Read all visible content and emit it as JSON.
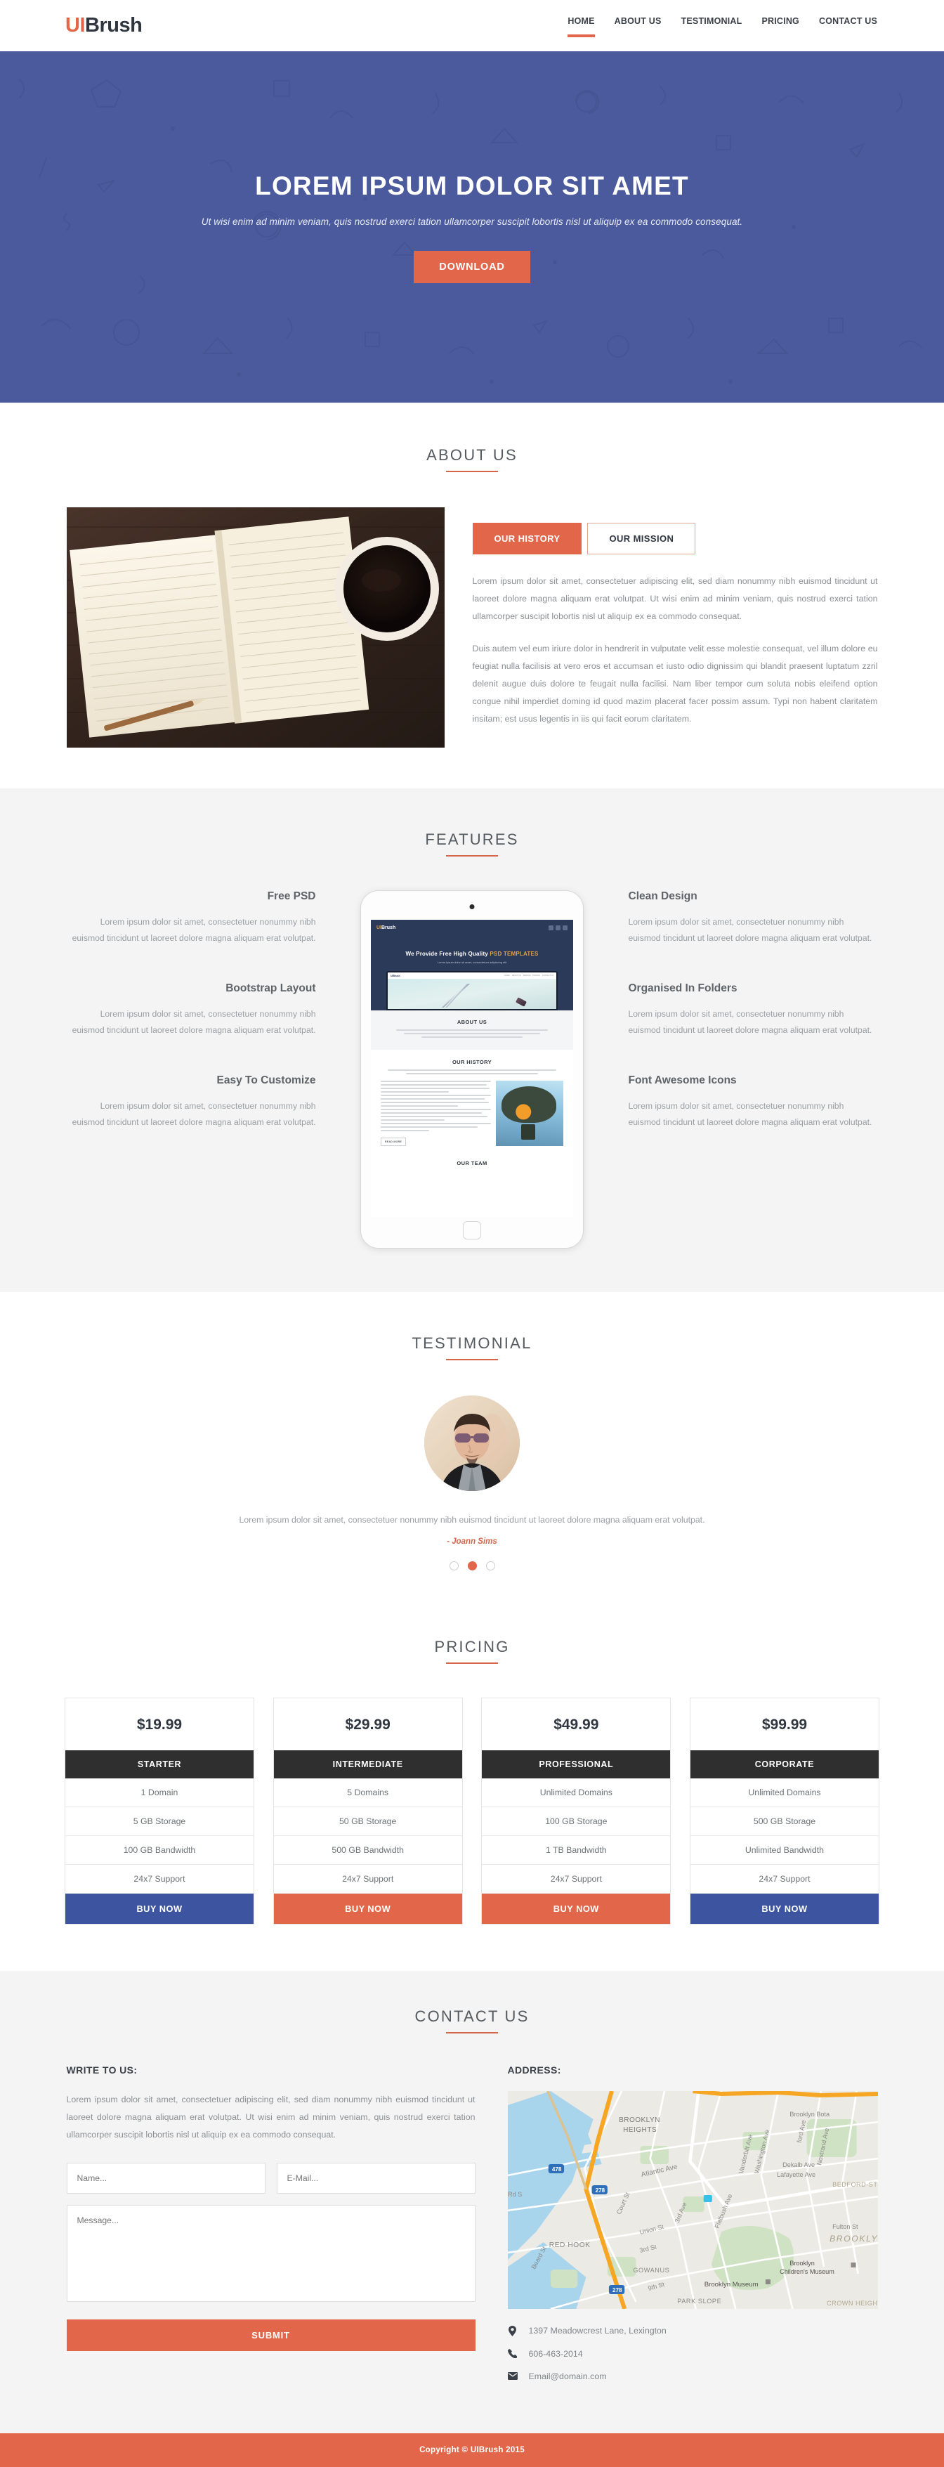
{
  "header": {
    "brand_prefix": "UI",
    "brand_suffix": "Brush",
    "nav": [
      {
        "label": "HOME",
        "active": true
      },
      {
        "label": "ABOUT US",
        "active": false
      },
      {
        "label": "TESTIMONIAL",
        "active": false
      },
      {
        "label": "PRICING",
        "active": false
      },
      {
        "label": "CONTACT US",
        "active": false
      }
    ]
  },
  "hero": {
    "title": "LOREM IPSUM DOLOR SIT AMET",
    "subtitle": "Ut wisi enim ad minim veniam, quis nostrud exerci tation ullamcorper suscipit lobortis nisl ut aliquip ex ea commodo consequat.",
    "button": "DOWNLOAD",
    "bg_color": "#4a5a9c",
    "accent_color": "#e2674a"
  },
  "about": {
    "title": "ABOUT US",
    "tabs": [
      {
        "label": "OUR HISTORY",
        "active": true
      },
      {
        "label": "OUR MISSION",
        "active": false
      }
    ],
    "paragraph1": "Lorem ipsum dolor sit amet, consectetuer adipiscing elit, sed diam nonummy nibh euismod tincidunt ut laoreet dolore magna aliquam erat volutpat. Ut wisi enim ad minim veniam, quis nostrud exerci tation ullamcorper suscipit lobortis nisl ut aliquip ex ea commodo consequat.",
    "paragraph2": "Duis autem vel eum iriure dolor in hendrerit in vulputate velit esse molestie consequat, vel illum dolore eu feugiat nulla facilisis at vero eros et accumsan et iusto odio dignissim qui blandit praesent luptatum zzril delenit augue duis dolore te feugait nulla facilisi. Nam liber tempor cum soluta nobis eleifend option congue nihil imperdiet doming id quod mazim placerat facer possim assum. Typi non habent claritatem insitam; est usus legentis in iis qui facit eorum claritatem."
  },
  "features": {
    "title": "FEATURES",
    "body_text": "Lorem ipsum dolor sit amet, consectetuer nonummy nibh euismod tincidunt ut laoreet dolore magna aliquam erat volutpat.",
    "left": [
      {
        "title": "Free PSD"
      },
      {
        "title": "Bootstrap Layout"
      },
      {
        "title": "Easy To Customize"
      }
    ],
    "right": [
      {
        "title": "Clean Design"
      },
      {
        "title": "Organised In Folders"
      },
      {
        "title": "Font Awesome Icons"
      }
    ],
    "mockup": {
      "logo_prefix": "UI",
      "logo_suffix": "Brush",
      "hero_title_plain": "We Provide Free High Quality ",
      "hero_title_accent": "PSD TEMPLATES",
      "hero_sub": "Lorem ipsum dolor sit amet, consectetuer adipiscing elit",
      "inner_logo": "UIBrush",
      "inner_nav": [
        "HOME",
        "ABOUT US",
        "SERVICE",
        "PRICING",
        "CONTACT US"
      ],
      "section_about": "ABOUT US",
      "section_history": "OUR HISTORY",
      "read_more": "READ MORE",
      "section_team": "OUR TEAM"
    }
  },
  "testimonial": {
    "title": "TESTIMONIAL",
    "quote": "Lorem ipsum dolor sit amet, consectetuer nonummy nibh euismod tincidunt ut laoreet dolore magna aliquam erat volutpat.",
    "author": "- Joann Sims",
    "dots": [
      {
        "active": false
      },
      {
        "active": true
      },
      {
        "active": false
      }
    ]
  },
  "pricing": {
    "title": "PRICING",
    "plans": [
      {
        "price": "$19.99",
        "name": "STARTER",
        "features": [
          "1 Domain",
          "5 GB Storage",
          "100 GB Bandwidth",
          "24x7 Support"
        ],
        "buy_label": "BUY NOW",
        "buy_color": "#3d55a0"
      },
      {
        "price": "$29.99",
        "name": "INTERMEDIATE",
        "features": [
          "5 Domains",
          "50 GB Storage",
          "500 GB Bandwidth",
          "24x7 Support"
        ],
        "buy_label": "BUY NOW",
        "buy_color": "#e2674a"
      },
      {
        "price": "$49.99",
        "name": "PROFESSIONAL",
        "features": [
          "Unlimited Domains",
          "100 GB Storage",
          "1 TB Bandwidth",
          "24x7 Support"
        ],
        "buy_label": "BUY NOW",
        "buy_color": "#e2674a"
      },
      {
        "price": "$99.99",
        "name": "CORPORATE",
        "features": [
          "Unlimited Domains",
          "500 GB Storage",
          "Unlimited Bandwidth",
          "24x7 Support"
        ],
        "buy_label": "BUY NOW",
        "buy_color": "#3d55a0"
      }
    ]
  },
  "contact": {
    "title": "CONTACT US",
    "write_label": "WRITE TO US:",
    "address_label": "ADDRESS:",
    "paragraph": "Lorem ipsum dolor sit amet, consectetuer adipiscing elit, sed diam nonummy nibh euismod tincidunt ut laoreet dolore magna aliquam erat volutpat. Ut wisi enim ad minim veniam, quis nostrud exerci tation ullamcorper suscipit lobortis nisl ut aliquip ex ea commodo consequat.",
    "name_placeholder": "Name...",
    "email_placeholder": "E-Mail...",
    "message_placeholder": "Message...",
    "submit_label": "SUBMIT",
    "address_line": "1397 Meadowcrest Lane, Lexington",
    "phone": "606-463-2014",
    "email": "Email@domain.com",
    "map_labels": [
      "BROOKLYN HEIGHTS",
      "Atlantic Ave",
      "Court St",
      "Union St",
      "3rd Ave",
      "3rd St",
      "9th St",
      "GOWANUS",
      "RED HOOK",
      "Beard St",
      "PARK SLOPE",
      "Flatbush Ave",
      "Vanderbilt Ave",
      "Washington Ave",
      "Dekalb Ave",
      "Lafayette Ave",
      "Nostrand Ave",
      "BEDFORD-STUY",
      "Fulton St",
      "BROOKLYN",
      "Brooklyn Museum",
      "Brooklyn Children's Museum",
      "Brooklyn Botanic Garden",
      "CROWN HEIGHTS",
      "478",
      "278"
    ]
  },
  "footer": {
    "copyright": "Copyright © UIBrush 2015"
  }
}
